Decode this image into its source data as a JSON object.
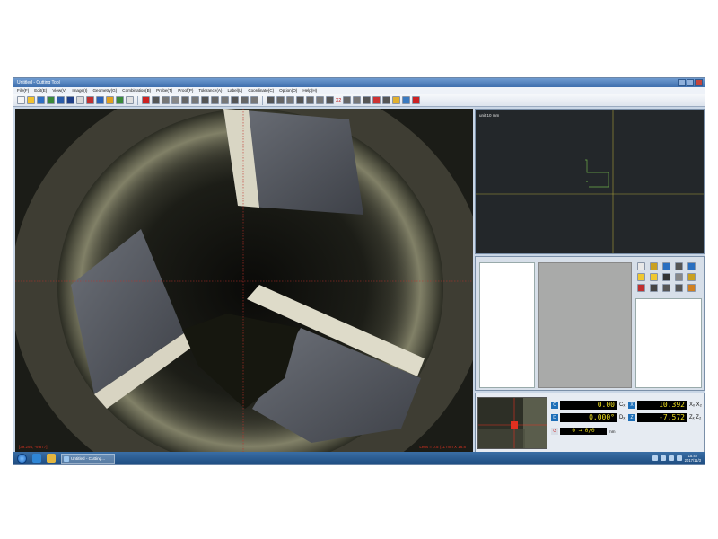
{
  "window": {
    "title": "Untitled - Cutting Tool"
  },
  "menu": [
    "File(F)",
    "Edit(E)",
    "View(V)",
    "Image(I)",
    "Geometry(G)",
    "Combination(B)",
    "Probe(T)",
    "Proof(P)",
    "Tolerance(A)",
    "Label(L)",
    "Coordinate(C)",
    "Option(O)",
    "Help(H)"
  ],
  "toolbar": {
    "icon_colors": [
      "#f4f4f4",
      "#f2c230",
      "#2f6fc4",
      "#3a8a3a",
      "#2a5caa",
      "#1f3f88",
      "#d9d9d9",
      "#c03030",
      "#2a62b8",
      "#e0a020",
      "#3a8a3a",
      "#e0e0e0",
      "#c22",
      "#555",
      "#777",
      "#888",
      "#666",
      "#777",
      "#555",
      "#666",
      "#777",
      "#555",
      "#666",
      "#777",
      "#555",
      "#666",
      "#777",
      "#555",
      "#666",
      "#777",
      "#555",
      "#666",
      "#777",
      "#555",
      "#c33",
      "#555",
      "#e0b030",
      "#3a7ac0",
      "#c22"
    ],
    "overlay_text": "X2"
  },
  "camera": {
    "status_left": "[39.294, -9.877]",
    "status_right": "Lens = 0.5 (11 mm   X 16.8"
  },
  "drawview": {
    "unit_label": "unit:10 mm"
  },
  "featpanel": {
    "tool_icon_colors": [
      "#e8e8e8",
      "#c9a020",
      "#2a6fc0",
      "#555",
      "#2a6fc0",
      "#f0c830",
      "#f0c830",
      "#333",
      "#888",
      "#c9a020",
      "#c03030",
      "#444",
      "#555",
      "#555",
      "#d08020"
    ]
  },
  "dro": {
    "c_label": "C",
    "c_value": "0.00",
    "c_axis": "Cₓ",
    "x_label": "X",
    "x_value": "10.392",
    "x_axis": "Xₓ X₂",
    "d_label": "D",
    "d_value": "0.000°",
    "d_axis": "Dₓ",
    "z_label": "Z",
    "z_value": "-7.572",
    "z_axis": "Zₓ Z₂",
    "ratio_value": "0 → 0/0",
    "ratio_unit": "mm"
  },
  "taskbar": {
    "app_label": "Untitled - Cutting...",
    "clock_time": "15:42",
    "clock_date": "2017/11/3"
  }
}
